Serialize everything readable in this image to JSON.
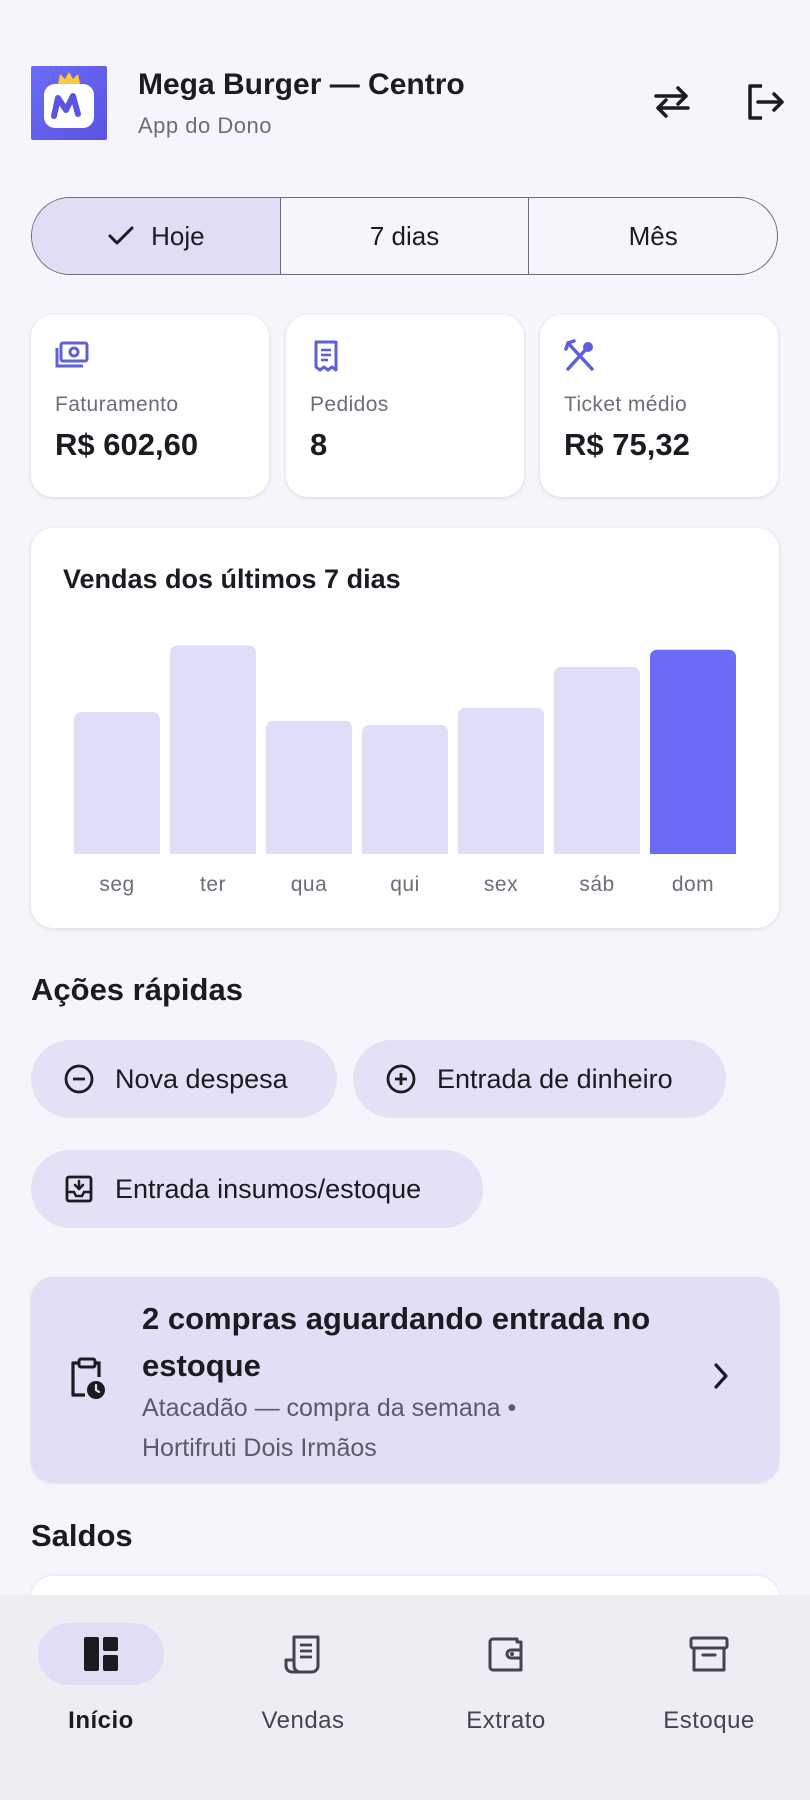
{
  "header": {
    "title": "Mega Burger — Centro",
    "subtitle": "App do Dono",
    "logo_icon": "mega-burger-logo",
    "switch_icon": "swap-horiz-icon",
    "logout_icon": "logout-icon"
  },
  "period_tabs": [
    {
      "label": "Hoje",
      "selected": true
    },
    {
      "label": "7 dias",
      "selected": false
    },
    {
      "label": "Mês",
      "selected": false
    }
  ],
  "stats": [
    {
      "icon": "payments-icon",
      "label": "Faturamento",
      "value": "R$ 602,60"
    },
    {
      "icon": "receipt-icon",
      "label": "Pedidos",
      "value": "8"
    },
    {
      "icon": "restaurant-icon",
      "label": "Ticket médio",
      "value": "R$ 75,32"
    }
  ],
  "chart_data": {
    "type": "bar",
    "title": "Vendas dos últimos 7 dias",
    "categories": [
      "seg",
      "ter",
      "qua",
      "qui",
      "sex",
      "sáb",
      "dom"
    ],
    "values": [
      0.66,
      0.97,
      0.62,
      0.6,
      0.68,
      0.87,
      0.95
    ],
    "ylim": [
      0,
      1
    ],
    "highlight_index": 6,
    "bar_color": "#DFDEF8",
    "highlight_color": "#6C6BF8"
  },
  "quick_actions": {
    "title": "Ações rápidas",
    "items": [
      {
        "label": "Nova despesa",
        "icon": "remove-circle-icon"
      },
      {
        "label": "Entrada de dinheiro",
        "icon": "add-circle-icon"
      },
      {
        "label": "Entrada insumos/estoque",
        "icon": "inventory-download-icon"
      }
    ]
  },
  "pending": {
    "title": "2 compras aguardando entrada no estoque",
    "subtitle": "Atacadão — compra da semana • Hortifruti Dois Irmãos",
    "icon": "pending-actions-icon"
  },
  "balances": {
    "title": "Saldos"
  },
  "bottom_nav": [
    {
      "label": "Início",
      "icon": "dashboard-icon",
      "active": true
    },
    {
      "label": "Vendas",
      "icon": "receipt-long-icon",
      "active": false
    },
    {
      "label": "Extrato",
      "icon": "wallet-icon",
      "active": false
    },
    {
      "label": "Estoque",
      "icon": "archive-box-icon",
      "active": false
    }
  ],
  "colors": {
    "accent": "#6C6BF8",
    "accent_light": "#DFDEF5",
    "background": "#F6F5FB"
  }
}
